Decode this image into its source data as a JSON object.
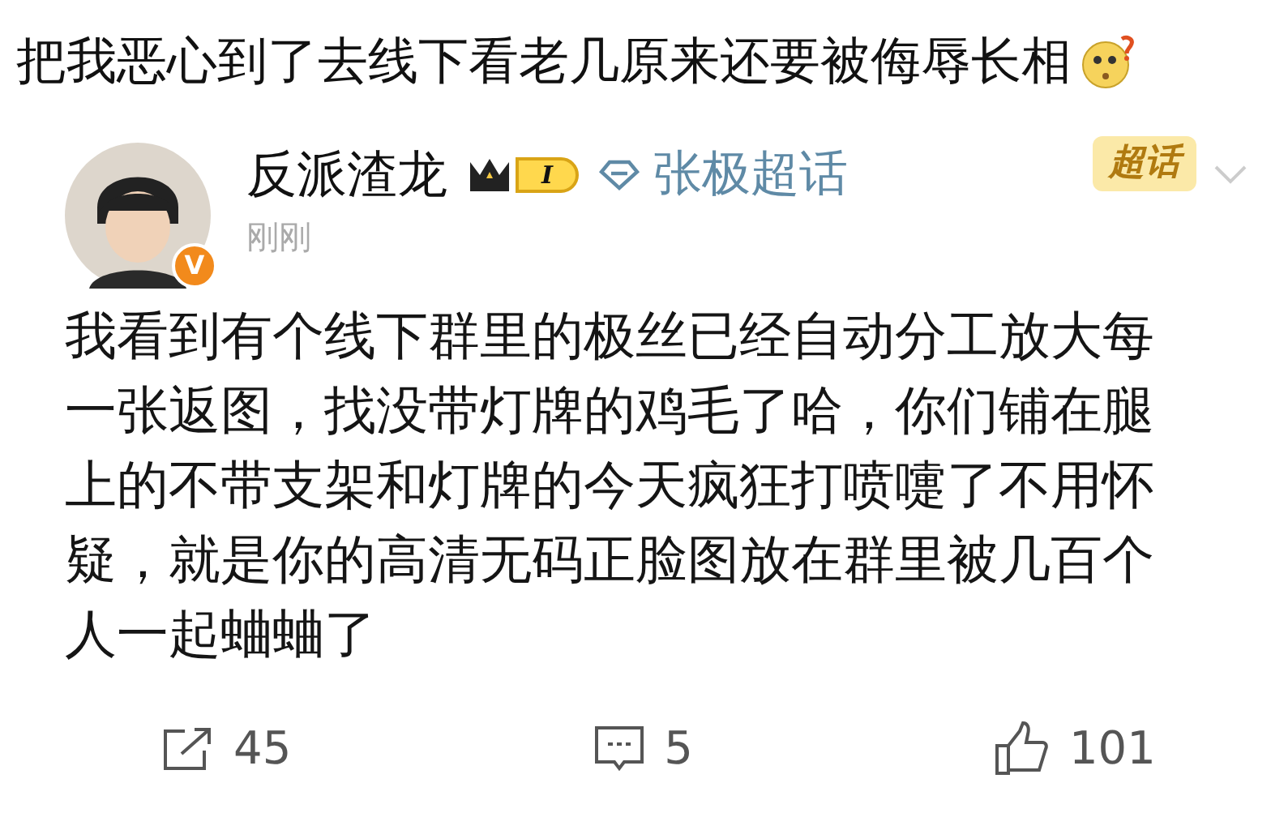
{
  "caption": "把我恶心到了去线下看老几原来还要被侮辱长相",
  "post": {
    "author": {
      "name": "反派渣龙",
      "level": "I",
      "verified_mark": "V"
    },
    "topic": "张极超话",
    "tag": "超话",
    "time": "刚刚",
    "body": "我看到有个线下群里的极丝已经自动分工放大每一张返图，找没带灯牌的鸡毛了哈，你们铺在腿上的不带支架和灯牌的今天疯狂打喷嚏了不用怀疑，就是你的高清无码正脸图放在群里被几百个人一起蛐蛐了"
  },
  "actions": [
    {
      "kind": "repost",
      "count": "45"
    },
    {
      "kind": "comment",
      "count": "5"
    },
    {
      "kind": "like",
      "count": "101"
    }
  ]
}
